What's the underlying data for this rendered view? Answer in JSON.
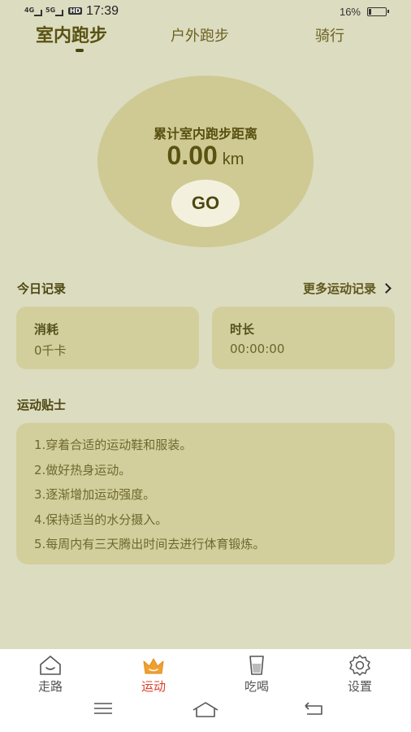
{
  "status_bar": {
    "signal1": "4G",
    "signal2": "5G",
    "hd": "HD",
    "time": "17:39",
    "battery": "16%"
  },
  "tabs": [
    {
      "label": "室内跑步",
      "active": true
    },
    {
      "label": "户外跑步",
      "active": false
    },
    {
      "label": "骑行",
      "active": false
    }
  ],
  "summary": {
    "title": "累计室内跑步距离",
    "distance": "0.00",
    "unit": "km",
    "go_label": "GO"
  },
  "today": {
    "title": "今日记录",
    "more_label": "更多运动记录",
    "cards": [
      {
        "title": "消耗",
        "value": "0千卡"
      },
      {
        "title": "时长",
        "value": "00:00:00"
      }
    ]
  },
  "tips": {
    "title": "运动贴士",
    "items": [
      "1.穿着合适的运动鞋和服装。",
      "2.做好热身运动。",
      "3.逐渐增加运动强度。",
      "4.保持适当的水分摄入。",
      "5.每周内有三天腾出时间去进行体育锻炼。"
    ]
  },
  "bottom_nav": [
    {
      "label": "走路",
      "icon": "house-smile-icon",
      "active": false
    },
    {
      "label": "运动",
      "icon": "crown-icon",
      "active": true
    },
    {
      "label": "吃喝",
      "icon": "cup-icon",
      "active": false
    },
    {
      "label": "设置",
      "icon": "gear-icon",
      "active": false
    }
  ],
  "colors": {
    "background": "#dcdcc1",
    "accent": "#d9412a",
    "card": "#d3cf9d"
  }
}
